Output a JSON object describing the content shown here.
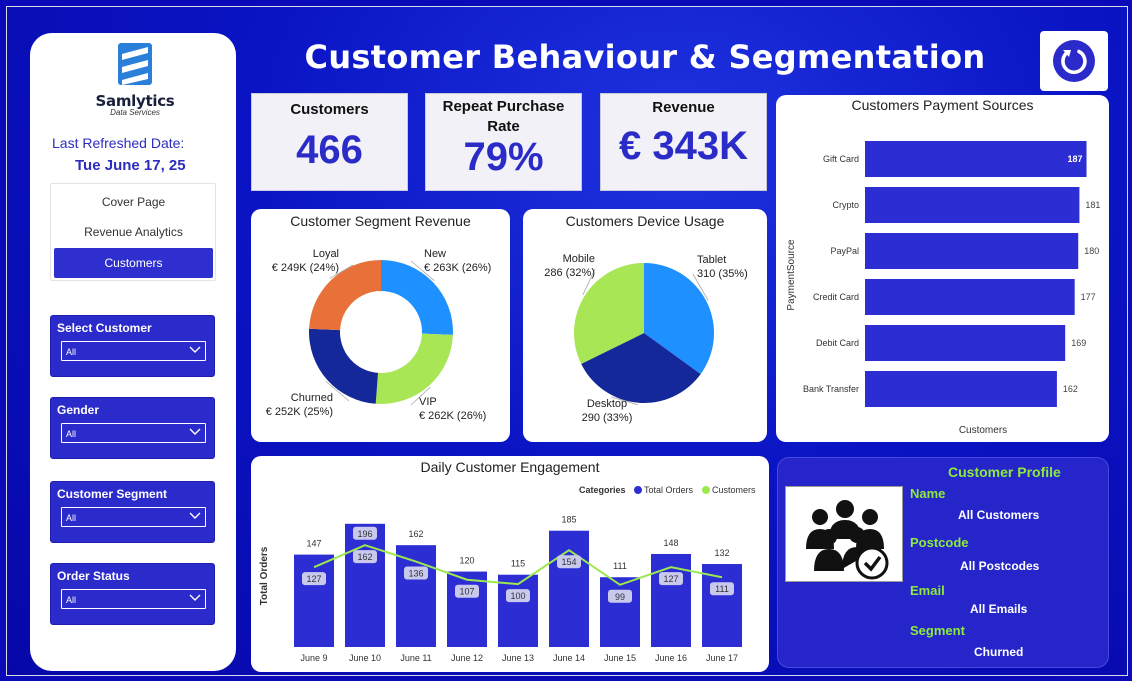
{
  "title": "Customer Behaviour & Segmentation",
  "brand": {
    "name": "Samlytics",
    "tagline": "Data Services"
  },
  "refresh": {
    "label": "Last Refreshed Date:",
    "date": "Tue June 17, 25"
  },
  "nav": [
    {
      "label": "Cover Page",
      "active": false
    },
    {
      "label": "Revenue Analytics",
      "active": false
    },
    {
      "label": "Customers",
      "active": true
    }
  ],
  "filters": [
    {
      "title": "Select Customer",
      "value": "All"
    },
    {
      "title": "Gender",
      "value": "All"
    },
    {
      "title": "Customer Segment",
      "value": "All"
    },
    {
      "title": "Order Status",
      "value": "All"
    }
  ],
  "kpis": [
    {
      "label": "Customers",
      "value": "466"
    },
    {
      "label": "Repeat Purchase Rate",
      "value": "79%"
    },
    {
      "label": "Revenue",
      "value": "€ 343K"
    }
  ],
  "colors": {
    "accent": "#2f2fcf",
    "bar": "#2d2dd4",
    "line": "#9be84f",
    "profile_label": "#8dea3d",
    "segment_loyal": "#e8713a",
    "segment_new": "#1e90ff",
    "segment_vip": "#a8e655",
    "segment_churned": "#14289a"
  },
  "icons": {
    "refresh": "refresh-icon",
    "profile": "group-check-icon",
    "dropdown": "chevron-down-icon"
  },
  "chart_data": [
    {
      "type": "bar",
      "title": "Customers Payment Sources",
      "orientation": "horizontal",
      "ylabel": "PaymentSource",
      "xlabel": "Customers",
      "categories": [
        "Gift Card",
        "Crypto",
        "PayPal",
        "Credit Card",
        "Debit Card",
        "Bank Transfer"
      ],
      "values": [
        187,
        181,
        180,
        177,
        169,
        162
      ],
      "xlim": [
        0,
        195
      ]
    },
    {
      "type": "pie",
      "style": "donut",
      "title": "Customer Segment Revenue",
      "slices": [
        {
          "name": "New",
          "value": 263,
          "label": "€ 263K (26%)"
        },
        {
          "name": "VIP",
          "value": 262,
          "label": "€ 262K (26%)"
        },
        {
          "name": "Churned",
          "value": 252,
          "label": "€ 252K (25%)"
        },
        {
          "name": "Loyal",
          "value": 249,
          "label": "€ 249K (24%)"
        }
      ]
    },
    {
      "type": "pie",
      "title": "Customers Device Usage",
      "slices": [
        {
          "name": "Tablet",
          "value": 310,
          "label": "310 (35%)"
        },
        {
          "name": "Desktop",
          "value": 290,
          "label": "290 (33%)"
        },
        {
          "name": "Mobile",
          "value": 286,
          "label": "286 (32%)"
        }
      ]
    },
    {
      "type": "bar",
      "title": "Daily Customer Engagement",
      "ylabel": "Total Orders",
      "legend_title": "Categories",
      "categories": [
        "June 9",
        "June 10",
        "June 11",
        "June 12",
        "June 13",
        "June 14",
        "June 15",
        "June 16",
        "June 17"
      ],
      "series": [
        {
          "name": "Total Orders",
          "kind": "bar",
          "values": [
            147,
            196,
            162,
            120,
            115,
            185,
            111,
            148,
            132
          ]
        },
        {
          "name": "Customers",
          "kind": "line",
          "values": [
            127,
            162,
            136,
            107,
            100,
            154,
            99,
            127,
            111
          ]
        }
      ],
      "ylim": [
        0,
        210
      ]
    }
  ],
  "profile": {
    "title": "Customer Profile",
    "fields": [
      {
        "label": "Name",
        "value": "All Customers"
      },
      {
        "label": "Postcode",
        "value": "All Postcodes"
      },
      {
        "label": "Email",
        "value": "All Emails"
      },
      {
        "label": "Segment",
        "value": "Churned"
      }
    ]
  }
}
